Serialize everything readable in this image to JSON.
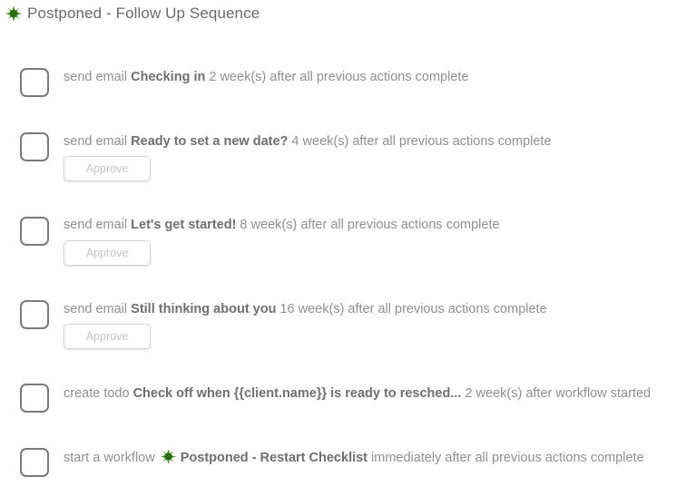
{
  "header": {
    "title": "Postponed - Follow Up Sequence",
    "icon": "green-burst-icon"
  },
  "approve_label": "Approve",
  "colors": {
    "burst": "#3a8a1e",
    "burst_center": "#2c6f13"
  },
  "steps": [
    {
      "prefix": "send email ",
      "name": "Checking in",
      "suffix": " 2 week(s) after all previous actions complete"
    },
    {
      "prefix": "send email ",
      "name": "Ready to set a new date?",
      "suffix": " 4 week(s) after all previous actions complete"
    },
    {
      "prefix": "send email ",
      "name": "Let's get started!",
      "suffix": " 8 week(s) after all previous actions complete"
    },
    {
      "prefix": "send email ",
      "name": "Still thinking about you",
      "suffix": " 16 week(s) after all previous actions complete"
    },
    {
      "prefix": "create todo ",
      "name": "Check off when {{client.name}} is ready to resched...",
      "suffix": " 2 week(s) after workflow started"
    },
    {
      "prefix": "start a workflow ",
      "name": "Postponed - Restart Checklist",
      "suffix": " immediately after all previous actions complete"
    }
  ]
}
